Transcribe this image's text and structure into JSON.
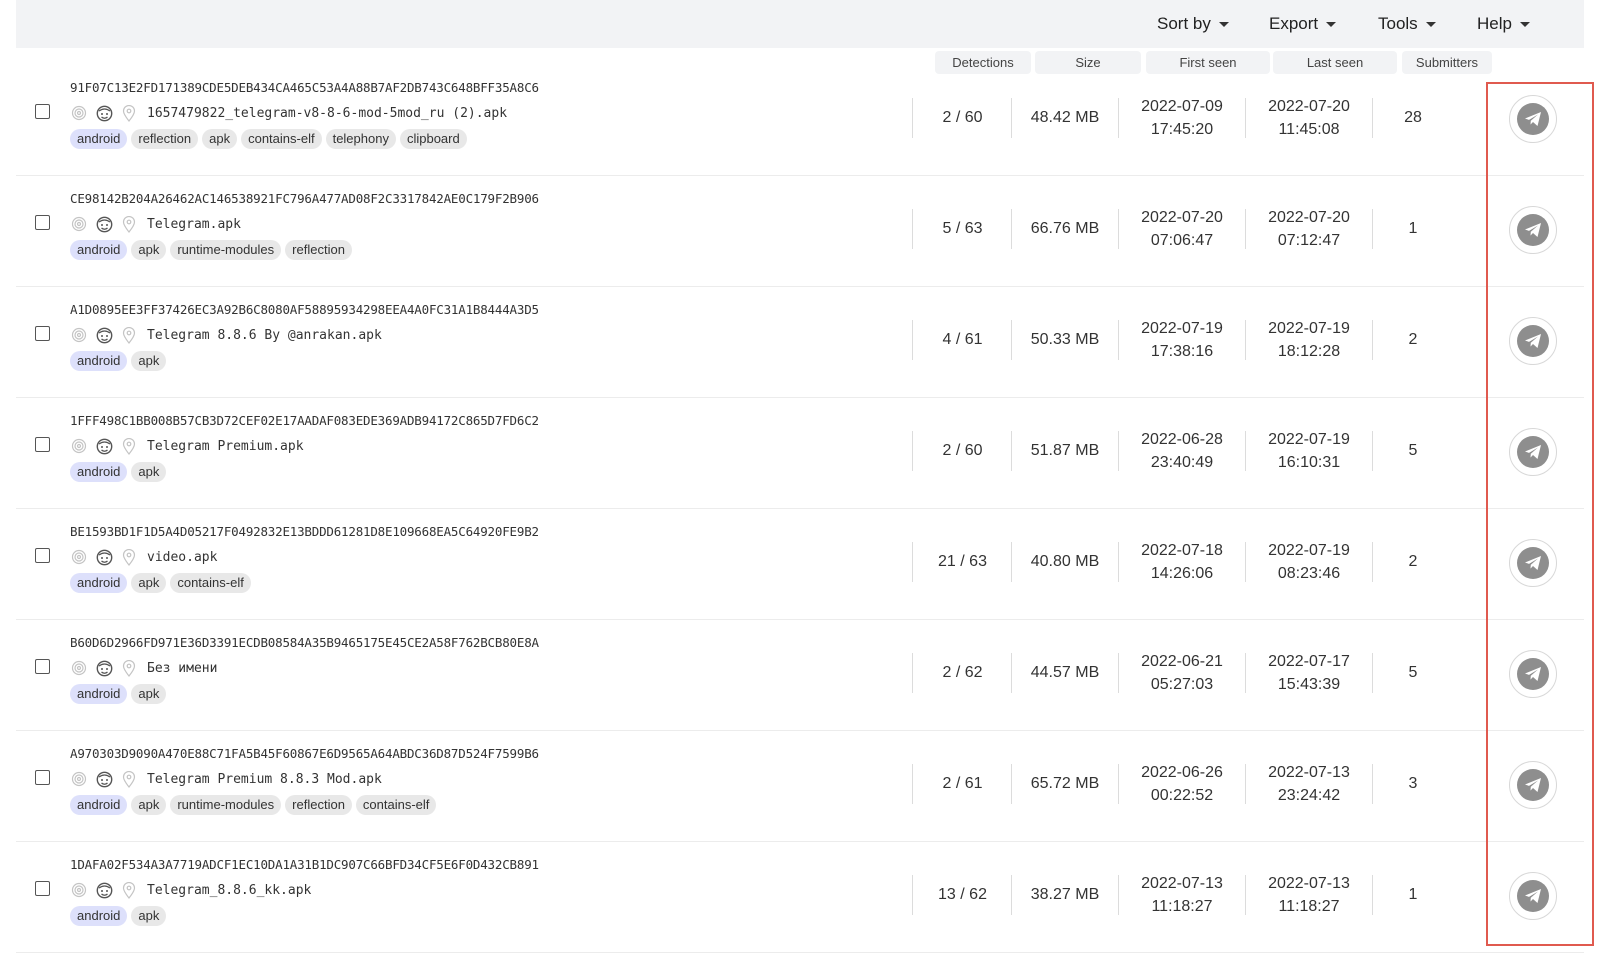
{
  "toolbar": {
    "sort_by": "Sort by",
    "export": "Export",
    "tools": "Tools",
    "help": "Help"
  },
  "columns": {
    "detections": "Detections",
    "size": "Size",
    "first_seen": "First seen",
    "last_seen": "Last seen",
    "submitters": "Submitters"
  },
  "icons": {
    "file_type": "fingerprint-icon",
    "community": "face-icon",
    "location": "location-pin-icon",
    "action": "telegram-send-icon"
  },
  "colors": {
    "highlight_border": "#e05a4f",
    "first_tag_bg": "#dde0fb",
    "tag_bg": "#e8e8e8",
    "action_circle": "#8e8e8e"
  },
  "rows": [
    {
      "hash": "91F07C13E2FD171389CDE5DEB434CA465C53A4A88B7AF2DB743C648BFF35A8C6",
      "filename": "1657479822_telegram-v8-8-6-mod-5mod_ru (2).apk",
      "tags": [
        "android",
        "reflection",
        "apk",
        "contains-elf",
        "telephony",
        "clipboard"
      ],
      "detections": "2 / 60",
      "size": "48.42 MB",
      "first_seen_date": "2022-07-09",
      "first_seen_time": "17:45:20",
      "last_seen_date": "2022-07-20",
      "last_seen_time": "11:45:08",
      "submitters": "28"
    },
    {
      "hash": "CE98142B204A26462AC146538921FC796A477AD08F2C3317842AE0C179F2B906",
      "filename": "Telegram.apk",
      "tags": [
        "android",
        "apk",
        "runtime-modules",
        "reflection"
      ],
      "detections": "5 / 63",
      "size": "66.76 MB",
      "first_seen_date": "2022-07-20",
      "first_seen_time": "07:06:47",
      "last_seen_date": "2022-07-20",
      "last_seen_time": "07:12:47",
      "submitters": "1"
    },
    {
      "hash": "A1D0895EE3FF37426EC3A92B6C8080AF58895934298EEA4A0FC31A1B8444A3D5",
      "filename": "Telegram 8.8.6 By @anrakan.apk",
      "tags": [
        "android",
        "apk"
      ],
      "detections": "4 / 61",
      "size": "50.33 MB",
      "first_seen_date": "2022-07-19",
      "first_seen_time": "17:38:16",
      "last_seen_date": "2022-07-19",
      "last_seen_time": "18:12:28",
      "submitters": "2"
    },
    {
      "hash": "1FFF498C1BB008B57CB3D72CEF02E17AADAF083EDE369ADB94172C865D7FD6C2",
      "filename": "Telegram Premium.apk",
      "tags": [
        "android",
        "apk"
      ],
      "detections": "2 / 60",
      "size": "51.87 MB",
      "first_seen_date": "2022-06-28",
      "first_seen_time": "23:40:49",
      "last_seen_date": "2022-07-19",
      "last_seen_time": "16:10:31",
      "submitters": "5"
    },
    {
      "hash": "BE1593BD1F1D5A4D05217F0492832E13BDDD61281D8E109668EA5C64920FE9B2",
      "filename": "video.apk",
      "tags": [
        "android",
        "apk",
        "contains-elf"
      ],
      "detections": "21 / 63",
      "size": "40.80 MB",
      "first_seen_date": "2022-07-18",
      "first_seen_time": "14:26:06",
      "last_seen_date": "2022-07-19",
      "last_seen_time": "08:23:46",
      "submitters": "2"
    },
    {
      "hash": "B60D6D2966FD971E36D3391ECDB08584A35B9465175E45CE2A58F762BCB80E8A",
      "filename": "Без имени",
      "tags": [
        "android",
        "apk"
      ],
      "detections": "2 / 62",
      "size": "44.57 MB",
      "first_seen_date": "2022-06-21",
      "first_seen_time": "05:27:03",
      "last_seen_date": "2022-07-17",
      "last_seen_time": "15:43:39",
      "submitters": "5"
    },
    {
      "hash": "A970303D9090A470E88C71FA5B45F60867E6D9565A64ABDC36D87D524F7599B6",
      "filename": "Telegram Premium 8.8.3 Mod.apk",
      "tags": [
        "android",
        "apk",
        "runtime-modules",
        "reflection",
        "contains-elf"
      ],
      "detections": "2 / 61",
      "size": "65.72 MB",
      "first_seen_date": "2022-06-26",
      "first_seen_time": "00:22:52",
      "last_seen_date": "2022-07-13",
      "last_seen_time": "23:24:42",
      "submitters": "3"
    },
    {
      "hash": "1DAFA02F534A3A7719ADCF1EC10DA1A31B1DC907C66BFD34CF5E6F0D432CB891",
      "filename": "Telegram_8.8.6_kk.apk",
      "tags": [
        "android",
        "apk"
      ],
      "detections": "13 / 62",
      "size": "38.27 MB",
      "first_seen_date": "2022-07-13",
      "first_seen_time": "11:18:27",
      "last_seen_date": "2022-07-13",
      "last_seen_time": "11:18:27",
      "submitters": "1"
    }
  ]
}
